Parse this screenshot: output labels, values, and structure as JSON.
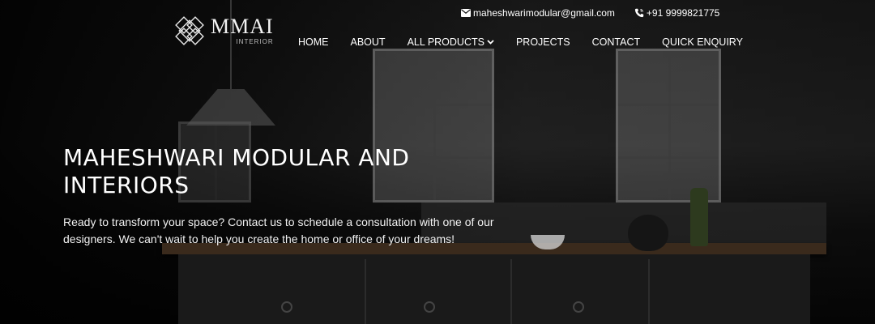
{
  "brand": {
    "name": "MMAI",
    "tagline": "INTERIOR"
  },
  "contact": {
    "email": "maheshwarimodular@gmail.com",
    "phone": "+91 9999821775"
  },
  "nav": {
    "items": [
      {
        "label": "HOME"
      },
      {
        "label": "ABOUT"
      },
      {
        "label": "ALL PRODUCTS"
      },
      {
        "label": "PROJECTS"
      },
      {
        "label": "CONTACT"
      },
      {
        "label": "QUICK ENQUIRY"
      }
    ]
  },
  "hero": {
    "title": "MAHESHWARI MODULAR AND INTERIORS",
    "text": "Ready to transform your space? Contact us to schedule a consultation with one of our designers. We can't wait to help you create the home or office of your dreams!"
  },
  "icons": {
    "email": "envelope-icon",
    "phone": "phone-icon",
    "dropdown": "chevron-down-icon"
  }
}
